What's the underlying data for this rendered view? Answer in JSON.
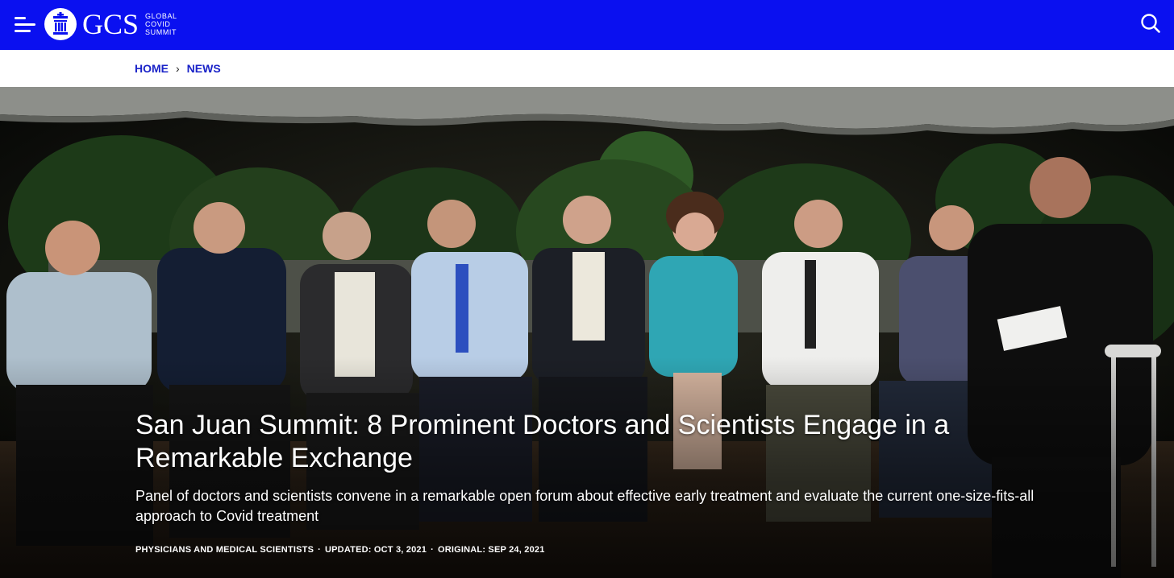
{
  "header": {
    "brand_short": "GCS",
    "brand_sub": [
      "GLOBAL",
      "COVID",
      "SUMMIT"
    ],
    "menu_icon": "hamburger-menu-icon",
    "search_icon": "search-icon",
    "logo_icon": "gcs-logo-icon",
    "background_color": "#0a10f0"
  },
  "breadcrumb": {
    "home": "HOME",
    "separator": "›",
    "current": "NEWS",
    "link_color": "#1a23c8"
  },
  "article": {
    "title": "San Juan Summit: 8 Prominent Doctors and Scientists Engage in a Remarkable Exchange",
    "subtitle": "Panel of doctors and scientists convene in a remarkable open forum about effective early treatment and evaluate the current one-size-fits-all approach to Covid treatment",
    "meta": {
      "category": "PHYSICIANS AND MEDICAL SCIENTISTS",
      "updated": "UPDATED: OCT 3, 2021",
      "original": "ORIGINAL: SEP 24, 2021",
      "separator": "·"
    }
  }
}
